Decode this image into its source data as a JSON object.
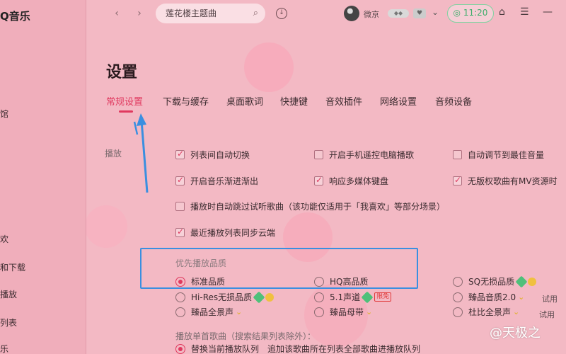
{
  "app": {
    "logo": "Q音乐"
  },
  "sidebar": {
    "items": [
      "馆",
      "欢",
      "和下载",
      "播放",
      "列表",
      "乐"
    ]
  },
  "topbar": {
    "search_text": "莲花楼主题曲",
    "username": "微京",
    "vip_text": "11:20"
  },
  "page": {
    "title": "设置",
    "tabs": [
      "常规设置",
      "下载与缓存",
      "桌面歌词",
      "快捷键",
      "音效插件",
      "网络设置",
      "音频设备"
    ],
    "section_label": "播放"
  },
  "options": {
    "row1": [
      "列表间自动切换",
      "开启手机遥控电脑播歌",
      "自动调节到最佳音量"
    ],
    "row2": [
      "开启音乐渐进渐出",
      "响应多媒体键盘",
      "无版权歌曲有MV资源时"
    ],
    "row3": "播放时自动跳过试听歌曲（该功能仅适用于「我喜欢」等部分场景）",
    "row4": "最近播放列表同步云端"
  },
  "quality": {
    "label": "优先播放品质",
    "standard": "标准品质",
    "hq": "HQ高品质",
    "sq": "SQ无损品质",
    "hires": "Hi-Res无损品质",
    "surround": "5.1声道",
    "master_eq": "臻品音质2.0",
    "panorama": "臻品全景声",
    "master_tape": "臻品母带",
    "dolby": "杜比全景声",
    "trial": "试用",
    "new_tag": "限免"
  },
  "single_song": {
    "label": "播放单首歌曲（搜索结果列表除外）：",
    "option1": "替换当前播放队列",
    "option2": "追加该歌曲所在列表全部歌曲进播放队列"
  },
  "watermark": "@天极之",
  "colors": {
    "accent": "#e0395f",
    "highlight": "#3a8fe0",
    "vip": "#3fae6c"
  }
}
